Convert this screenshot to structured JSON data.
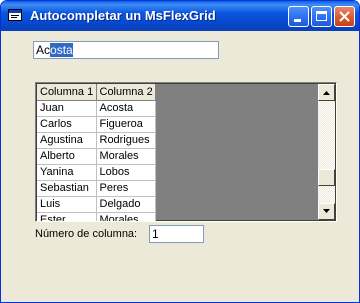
{
  "window": {
    "title": "Autocompletar un MsFlexGrid"
  },
  "search": {
    "value_plain": "Ac",
    "value_selected": "osta"
  },
  "grid": {
    "headers": [
      "Columna 1",
      "Columna 2"
    ],
    "rows": [
      [
        "Juan",
        "Acosta"
      ],
      [
        "Carlos",
        "Figueroa"
      ],
      [
        "Agustina",
        "Rodrigues"
      ],
      [
        "Alberto",
        "Morales"
      ],
      [
        "Yanina",
        "Lobos"
      ],
      [
        "Sebastian",
        "Peres"
      ],
      [
        "Luis",
        "Delgado"
      ],
      [
        "Ester",
        "Morales"
      ]
    ],
    "scroll_position": 0.8
  },
  "column_number": {
    "label": "Número de columna:",
    "value": "1"
  },
  "colors": {
    "titlebar": "#0a56e0",
    "face": "#ece9d8",
    "grid_empty": "#808080",
    "selection": "#316ac5"
  }
}
